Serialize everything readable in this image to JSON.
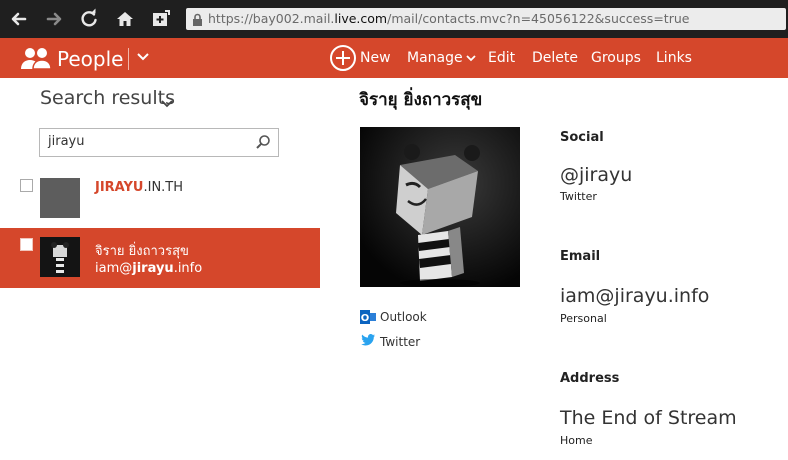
{
  "browser": {
    "url_prefix": "https://bay002.mail.",
    "url_domain": "live.com",
    "url_suffix": "/mail/contacts.mvc?n=45056122&success=true"
  },
  "app": {
    "title": "People",
    "commands": {
      "new": "New",
      "manage": "Manage",
      "edit": "Edit",
      "delete": "Delete",
      "groups": "Groups",
      "links": "Links"
    }
  },
  "search": {
    "heading": "Search results",
    "query": "jirayu"
  },
  "results": [
    {
      "name_highlight": "JIRAYU",
      "name_rest": ".IN.TH"
    },
    {
      "name": "จิราย ยิ่งถาวรสุข",
      "email_prefix": "iam@",
      "email_highlight": "jirayu",
      "email_suffix": ".info"
    }
  ],
  "contact": {
    "name": "จิรายุ ยิ่งถาวรสุข",
    "sources": [
      "Outlook",
      "Twitter"
    ],
    "social_label": "Social",
    "social_value": "@jirayu",
    "social_sub": "Twitter",
    "email_label": "Email",
    "email_value": "iam@jirayu.info",
    "email_sub": "Personal",
    "address_label": "Address",
    "address_value": "The End of Stream",
    "address_sub": "Home"
  },
  "colors": {
    "accent": "#d5472b",
    "chrome": "#1f1f1f"
  }
}
